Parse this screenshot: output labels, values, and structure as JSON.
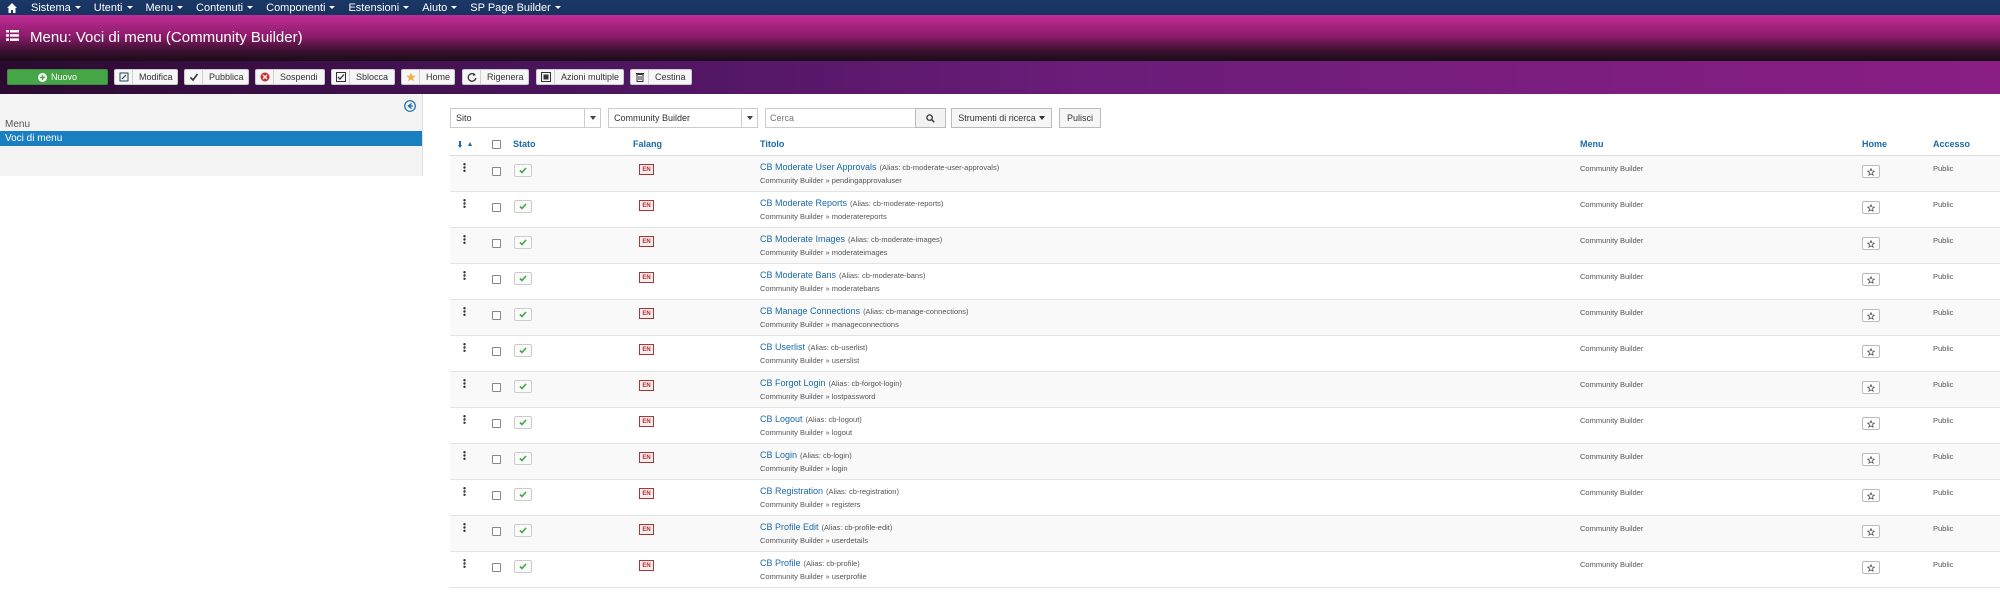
{
  "nav": {
    "items": [
      "Sistema",
      "Utenti",
      "Menu",
      "Contenuti",
      "Componenti",
      "Estensioni",
      "Aiuto",
      "SP Page Builder"
    ]
  },
  "header": {
    "title": "Menu: Voci di menu (Community Builder)"
  },
  "toolbar": {
    "new": "Nuovo",
    "edit": "Modifica",
    "publish": "Pubblica",
    "unpublish": "Sospendi",
    "checkin": "Sblocca",
    "home": "Home",
    "rebuild": "Rigenera",
    "batch": "Azioni multiple",
    "trash": "Cestina"
  },
  "sidebar": {
    "heading": "Menu",
    "active_item": "Voci di menu"
  },
  "filters": {
    "site": "Sito",
    "menu": "Community Builder",
    "search_placeholder": "Cerca",
    "tools": "Strumenti di ricerca",
    "clear": "Pulisci"
  },
  "table": {
    "headers": {
      "status": "Stato",
      "flag": "Falang",
      "title": "Titolo",
      "menu": "Menu",
      "home": "Home",
      "access": "Accesso"
    },
    "rows": [
      {
        "title": "CB Moderate User Approvals",
        "alias": "(Alias: cb-moderate-user-approvals)",
        "sub": "Community Builder » pendingapprovaluser",
        "menu": "Community Builder",
        "access": "Public"
      },
      {
        "title": "CB Moderate Reports",
        "alias": "(Alias: cb-moderate-reports)",
        "sub": "Community Builder » moderatereports",
        "menu": "Community Builder",
        "access": "Public"
      },
      {
        "title": "CB Moderate Images",
        "alias": "(Alias: cb-moderate-images)",
        "sub": "Community Builder » moderateimages",
        "menu": "Community Builder",
        "access": "Public"
      },
      {
        "title": "CB Moderate Bans",
        "alias": "(Alias: cb-moderate-bans)",
        "sub": "Community Builder » moderatebans",
        "menu": "Community Builder",
        "access": "Public"
      },
      {
        "title": "CB Manage Connections",
        "alias": "(Alias: cb-manage-connections)",
        "sub": "Community Builder » manageconnections",
        "menu": "Community Builder",
        "access": "Public"
      },
      {
        "title": "CB Userlist",
        "alias": "(Alias: cb-userlist)",
        "sub": "Community Builder » userslist",
        "menu": "Community Builder",
        "access": "Public"
      },
      {
        "title": "CB Forgot Login",
        "alias": "(Alias: cb-forgot-login)",
        "sub": "Community Builder » lostpassword",
        "menu": "Community Builder",
        "access": "Public"
      },
      {
        "title": "CB Logout",
        "alias": "(Alias: cb-logout)",
        "sub": "Community Builder » logout",
        "menu": "Community Builder",
        "access": "Public"
      },
      {
        "title": "CB Login",
        "alias": "(Alias: cb-login)",
        "sub": "Community Builder » login",
        "menu": "Community Builder",
        "access": "Public"
      },
      {
        "title": "CB Registration",
        "alias": "(Alias: cb-registration)",
        "sub": "Community Builder » registers",
        "menu": "Community Builder",
        "access": "Public"
      },
      {
        "title": "CB Profile Edit",
        "alias": "(Alias: cb-profile-edit)",
        "sub": "Community Builder » userdetails",
        "menu": "Community Builder",
        "access": "Public"
      },
      {
        "title": "CB Profile",
        "alias": "(Alias: cb-profile)",
        "sub": "Community Builder » userprofile",
        "menu": "Community Builder",
        "access": "Public"
      }
    ]
  },
  "flag_text": "EN",
  "colors": {
    "nav": "#1a3867",
    "header_accent": "#c02c96",
    "new_button": "#46a546",
    "active": "#1a7fc1",
    "link": "#1a6aa9"
  }
}
